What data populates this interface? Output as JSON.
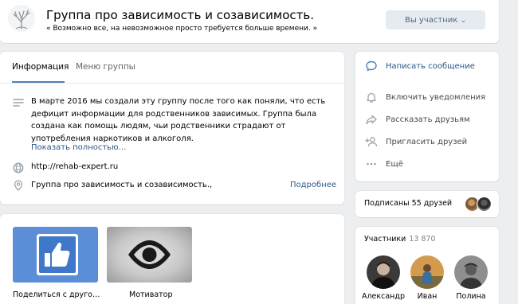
{
  "header": {
    "title": "Группа про зависимость и созависимость.",
    "status": "« Возможно все, на невозможное просто требуется больше времени. »",
    "member_button": "Вы участник"
  },
  "info": {
    "tabs": [
      {
        "label": "Информация",
        "active": true
      },
      {
        "label": "Меню группы",
        "active": false
      }
    ],
    "description": "В марте 2016 мы создали эту группу после того как поняли, что есть дефицит информации для родственников зависимых. Группа была создана как помощь людям, чьи родственники страдают от употребления наркотиков и алкоголя.",
    "show_more": "Показать полностью…",
    "website": "http://rehab-expert.ru",
    "place": "Группа про зависимость и созависимость.,",
    "more_link": "Подробнее"
  },
  "actions": [
    {
      "label": "Написать сообщение",
      "icon": "message-bubble-icon",
      "primary": true
    },
    {
      "label": "Включить уведомления",
      "icon": "bell-icon",
      "primary": false
    },
    {
      "label": "Рассказать друзьям",
      "icon": "share-arrow-icon",
      "primary": false
    },
    {
      "label": "Пригласить друзей",
      "icon": "invite-user-icon",
      "primary": false
    },
    {
      "label": "Ещё",
      "icon": "more-dots-icon",
      "primary": false
    }
  ],
  "friends": {
    "text": "Подписаны 55 друзей"
  },
  "media": {
    "items": [
      {
        "label": "Поделиться с друго…",
        "icon": "thumbs-up-icon"
      },
      {
        "label": "Мотиватор",
        "icon": "eye-icon"
      }
    ]
  },
  "members": {
    "title": "Участники",
    "count": "13 870",
    "people": [
      {
        "name": "Александр"
      },
      {
        "name": "Иван"
      },
      {
        "name": "Полина"
      }
    ]
  },
  "colors": {
    "background": "#edeef0",
    "link": "#2a5885",
    "accent": "#5181b8",
    "icon": "#99a2ad",
    "button_bg": "#e5ebf1",
    "share_tile": "#5b8ed6"
  }
}
